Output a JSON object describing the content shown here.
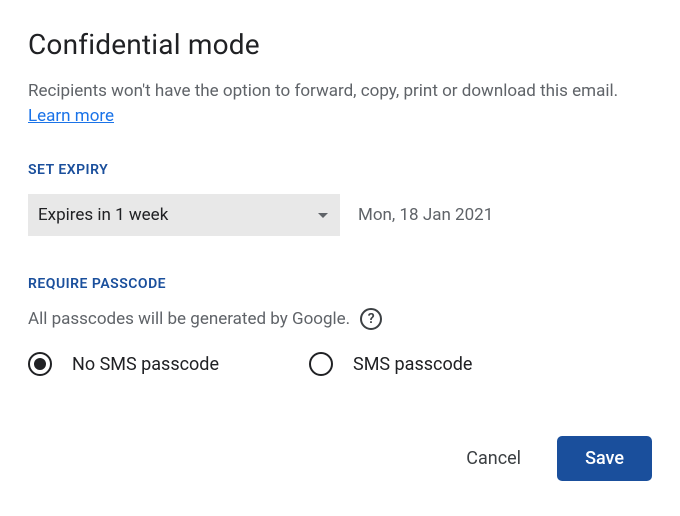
{
  "title": "Confidential mode",
  "description": "Recipients won't have the option to forward, copy, print or download this email. ",
  "learn_more": "Learn more",
  "expiry": {
    "header": "SET EXPIRY",
    "selected": "Expires in 1 week",
    "date": "Mon, 18 Jan 2021"
  },
  "passcode": {
    "header": "REQUIRE PASSCODE",
    "description": "All passcodes will be generated by Google.",
    "help_glyph": "?",
    "options": {
      "no_sms": "No SMS passcode",
      "sms": "SMS passcode"
    }
  },
  "buttons": {
    "cancel": "Cancel",
    "save": "Save"
  }
}
